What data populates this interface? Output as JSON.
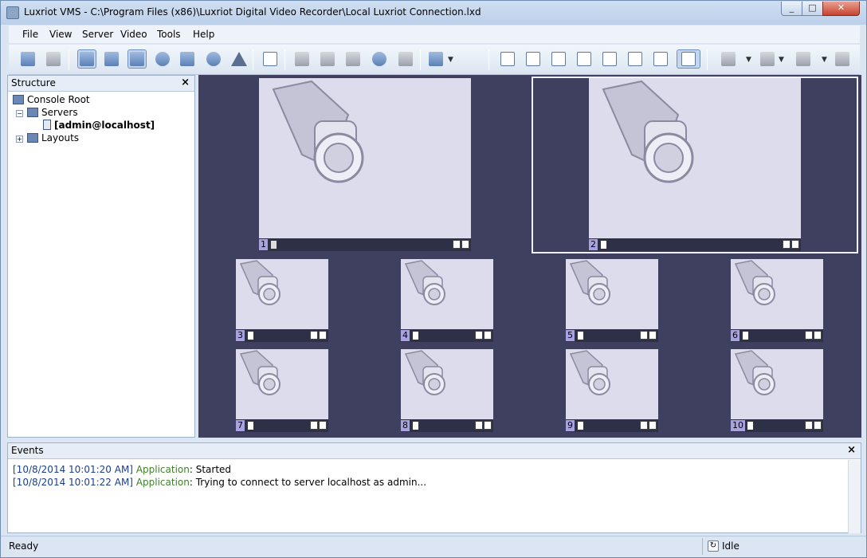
{
  "window": {
    "title": "Luxriot VMS - C:\\Program Files (x86)\\Luxriot Digital Video Recorder\\Local Luxriot Connection.lxd",
    "min": "_",
    "max": "□",
    "close": "✕"
  },
  "menu": [
    "File",
    "View",
    "Server",
    "Video",
    "Tools",
    "Help"
  ],
  "toolbar": {
    "icons": [
      "open-icon",
      "save-icon",
      "structure-icon",
      "search-icon",
      "edit-icon",
      "face-icon",
      "layout-list-icon",
      "record-icon",
      "alert-icon",
      "fullscreen-icon",
      "ptz-icon",
      "ptz-group-icon",
      "play-icon",
      "browser-icon",
      "export-icon",
      "workstation-icon",
      "layout-1x1-icon",
      "layout-2x2-icon",
      "layout-3x3-icon",
      "layout-4x4-icon",
      "layout-1p5-icon",
      "layout-1p7-icon",
      "layout-custom-icon",
      "layout-1p12-icon",
      "camera-settings-icon",
      "hand-icon",
      "motion-icon",
      "window-icon"
    ]
  },
  "structure": {
    "title": "Structure",
    "close": "×",
    "tree": {
      "root": "Console Root",
      "servers": "Servers",
      "server_entry": "[admin@localhost]",
      "layouts": "Layouts"
    }
  },
  "cameras": [
    "1",
    "2",
    "3",
    "4",
    "5",
    "6",
    "7",
    "8",
    "9",
    "10"
  ],
  "events": {
    "title": "Events",
    "close": "×",
    "lines": [
      {
        "time": "[10/8/2014 10:01:20 AM]",
        "source": "Application",
        "message": ": Started"
      },
      {
        "time": "[10/8/2014 10:01:22 AM]",
        "source": "Application",
        "message": ": Trying to connect to server localhost as admin..."
      }
    ]
  },
  "status": {
    "left": "Ready",
    "right": "Idle"
  }
}
